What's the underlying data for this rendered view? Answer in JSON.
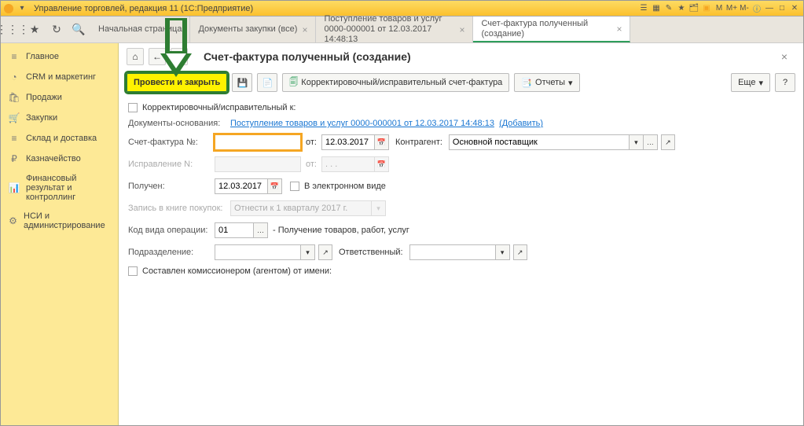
{
  "titlebar": {
    "title": "Управление торговлей, редакция 11  (1С:Предприятие)"
  },
  "tabs": [
    {
      "label": "Начальная страница",
      "closable": false
    },
    {
      "label": "Документы закупки (все)",
      "closable": true
    },
    {
      "label": "Поступление товаров и услуг 0000-000001 от 12.03.2017 14:48:13",
      "closable": true
    },
    {
      "label": "Счет-фактура полученный (создание)",
      "closable": true,
      "active": true
    }
  ],
  "sidebar": [
    {
      "icon": "≡",
      "label": "Главное"
    },
    {
      "icon": "◔",
      "label": "CRM и маркетинг"
    },
    {
      "icon": "🛍",
      "label": "Продажи"
    },
    {
      "icon": "🛒",
      "label": "Закупки"
    },
    {
      "icon": "≡",
      "label": "Склад и доставка"
    },
    {
      "icon": "₽",
      "label": "Казначейство"
    },
    {
      "icon": "📊",
      "label": "Финансовый результат и контроллинг"
    },
    {
      "icon": "⚙",
      "label": "НСИ и администрирование"
    }
  ],
  "page": {
    "title": "Счет-фактура полученный (создание)"
  },
  "toolbar": {
    "post_and_close": "Провести и закрыть",
    "correction": "Корректировочный/исправительный счет-фактура",
    "reports": "Отчеты",
    "more": "Еще"
  },
  "form": {
    "korr_label": "Корректировочный/исправительный к:",
    "basis_label": "Документы-основания:",
    "basis_link": "Поступление товаров и услуг 0000-000001 от 12.03.2017 14:48:13",
    "basis_add": "(Добавить)",
    "sf_num_label": "Счет-фактура №:",
    "sf_num_value": "",
    "ot_label": "от:",
    "sf_date": "12.03.2017",
    "kontragent_label": "Контрагент:",
    "kontragent_value": "Основной поставщик",
    "ispr_label": "Исправление N:",
    "ispr_date": ". . .",
    "received_label": "Получен:",
    "received_date": "12.03.2017",
    "electronic_label": "В электронном виде",
    "book_label": "Запись в книге покупок:",
    "book_value": "Отнести к 1 кварталу 2017 г.",
    "op_code_label": "Код вида операции:",
    "op_code_value": "01",
    "op_code_hint": "- Получение товаров, работ, услуг",
    "division_label": "Подразделение:",
    "division_value": "",
    "responsible_label": "Ответственный:",
    "responsible_value": "",
    "komission_label": "Составлен комиссионером (агентом) от имени:"
  }
}
